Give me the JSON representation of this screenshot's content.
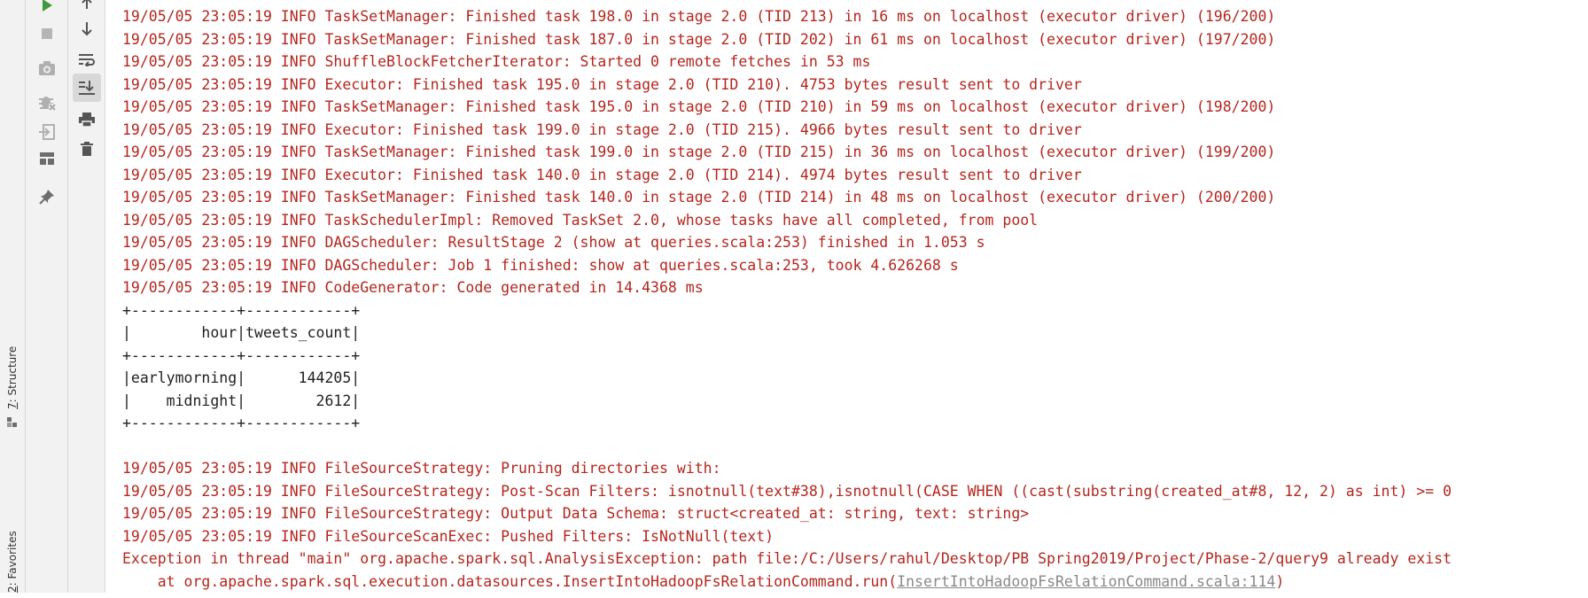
{
  "side_tabs": {
    "structure": {
      "num": "7",
      "text": ": Structure"
    },
    "favorites": {
      "num": "2",
      "text": ": Favorites"
    }
  },
  "toolbar": {
    "icons": [
      "run-icon",
      "stop-icon",
      "camera-icon",
      "debug-icon",
      "login-icon",
      "layout-icon",
      "pin-icon"
    ],
    "icons2": [
      "up-arrow-icon",
      "down-arrow-icon",
      "soft-wrap-icon",
      "scroll-to-end-icon",
      "print-icon",
      "trash-icon"
    ],
    "active": "scroll-to-end-icon"
  },
  "console": {
    "lines": [
      {
        "kind": "log",
        "text": "19/05/05 23:05:19 INFO TaskSetManager: Finished task 198.0 in stage 2.0 (TID 213) in 16 ms on localhost (executor driver) (196/200)"
      },
      {
        "kind": "log",
        "text": "19/05/05 23:05:19 INFO TaskSetManager: Finished task 187.0 in stage 2.0 (TID 202) in 61 ms on localhost (executor driver) (197/200)"
      },
      {
        "kind": "log",
        "text": "19/05/05 23:05:19 INFO ShuffleBlockFetcherIterator: Started 0 remote fetches in 53 ms"
      },
      {
        "kind": "log",
        "text": "19/05/05 23:05:19 INFO Executor: Finished task 195.0 in stage 2.0 (TID 210). 4753 bytes result sent to driver"
      },
      {
        "kind": "log",
        "text": "19/05/05 23:05:19 INFO TaskSetManager: Finished task 195.0 in stage 2.0 (TID 210) in 59 ms on localhost (executor driver) (198/200)"
      },
      {
        "kind": "log",
        "text": "19/05/05 23:05:19 INFO Executor: Finished task 199.0 in stage 2.0 (TID 215). 4966 bytes result sent to driver"
      },
      {
        "kind": "log",
        "text": "19/05/05 23:05:19 INFO TaskSetManager: Finished task 199.0 in stage 2.0 (TID 215) in 36 ms on localhost (executor driver) (199/200)"
      },
      {
        "kind": "log",
        "text": "19/05/05 23:05:19 INFO Executor: Finished task 140.0 in stage 2.0 (TID 214). 4974 bytes result sent to driver"
      },
      {
        "kind": "log",
        "text": "19/05/05 23:05:19 INFO TaskSetManager: Finished task 140.0 in stage 2.0 (TID 214) in 48 ms on localhost (executor driver) (200/200)"
      },
      {
        "kind": "log",
        "text": "19/05/05 23:05:19 INFO TaskSchedulerImpl: Removed TaskSet 2.0, whose tasks have all completed, from pool"
      },
      {
        "kind": "log",
        "text": "19/05/05 23:05:19 INFO DAGScheduler: ResultStage 2 (show at queries.scala:253) finished in 1.053 s"
      },
      {
        "kind": "log",
        "text": "19/05/05 23:05:19 INFO DAGScheduler: Job 1 finished: show at queries.scala:253, took 4.626268 s"
      },
      {
        "kind": "log",
        "text": "19/05/05 23:05:19 INFO CodeGenerator: Code generated in 14.4368 ms"
      },
      {
        "kind": "plain",
        "text": "+------------+------------+"
      },
      {
        "kind": "plain",
        "text": "|        hour|tweets_count|"
      },
      {
        "kind": "plain",
        "text": "+------------+------------+"
      },
      {
        "kind": "plain",
        "text": "|earlymorning|      144205|"
      },
      {
        "kind": "plain",
        "text": "|    midnight|        2612|"
      },
      {
        "kind": "plain",
        "text": "+------------+------------+"
      },
      {
        "kind": "plain",
        "text": ""
      },
      {
        "kind": "log",
        "text": "19/05/05 23:05:19 INFO FileSourceStrategy: Pruning directories with:"
      },
      {
        "kind": "log",
        "text": "19/05/05 23:05:19 INFO FileSourceStrategy: Post-Scan Filters: isnotnull(text#38),isnotnull(CASE WHEN ((cast(substring(created_at#8, 12, 2) as int) >= 0"
      },
      {
        "kind": "log",
        "text": "19/05/05 23:05:19 INFO FileSourceStrategy: Output Data Schema: struct<created_at: string, text: string>"
      },
      {
        "kind": "log",
        "text": "19/05/05 23:05:19 INFO FileSourceScanExec: Pushed Filters: IsNotNull(text)"
      },
      {
        "kind": "log",
        "text": "Exception in thread \"main\" org.apache.spark.sql.AnalysisException: path file:/C:/Users/rahul/Desktop/PB Spring2019/Project/Phase-2/query9 already exist"
      }
    ],
    "trace": {
      "prefix": "    at org.apache.spark.sql.execution.datasources.InsertIntoHadoopFsRelationCommand.run(",
      "link": "InsertIntoHadoopFsRelationCommand.scala:114",
      "suffix": ")"
    }
  },
  "colors": {
    "error_text": "#b3261e",
    "plain_text": "#1f1f1f",
    "link": "#888888",
    "toolbar_bg": "#f2f2f2"
  }
}
